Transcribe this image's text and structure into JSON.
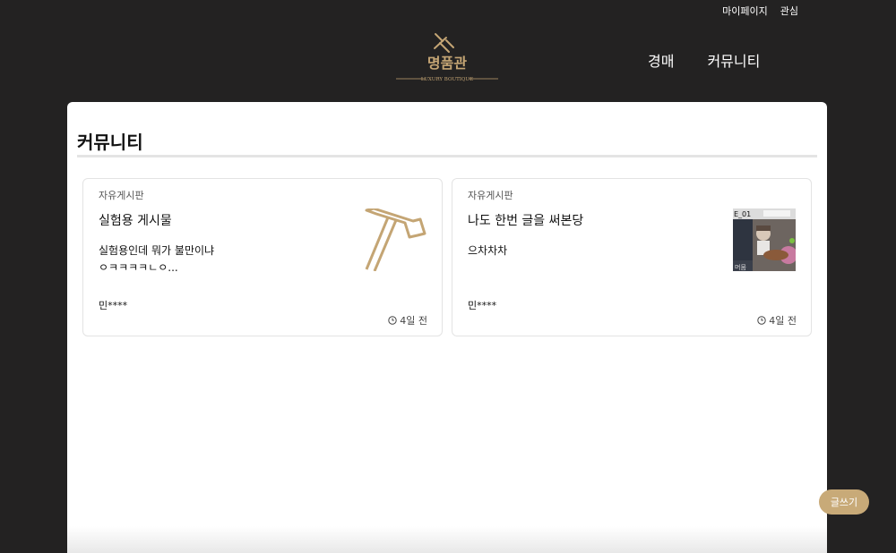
{
  "header": {
    "top_links": [
      "마이페이지",
      "관심"
    ],
    "logo_text": "명품관",
    "logo_sub": "LUXURY BOUTIQUE",
    "nav": [
      "경매",
      "커뮤니티"
    ]
  },
  "main": {
    "title": "커뮤니티",
    "posts": [
      {
        "category": "자유게시판",
        "title": "실험용 게시물",
        "body": "실험용인데 뭐가 불만이냐\nㅇㅋㅋㅋㅋㄴㅇ...",
        "author": "민****",
        "time": "4일 전",
        "thumb_icon": "gavel-icon"
      },
      {
        "category": "자유게시판",
        "title": "나도 한번 글을 써본당",
        "body": "으차차차",
        "author": "민****",
        "time": "4일 전",
        "thumb_icon": "game-screenshot-thumbnail",
        "thumb_text_1": "E_01",
        "thumb_text_2": "머뭄"
      }
    ]
  },
  "write_button": "글쓰기",
  "colors": {
    "background": "#232222",
    "accent": "#c8aa78",
    "logo_gold": "#c4a574"
  }
}
